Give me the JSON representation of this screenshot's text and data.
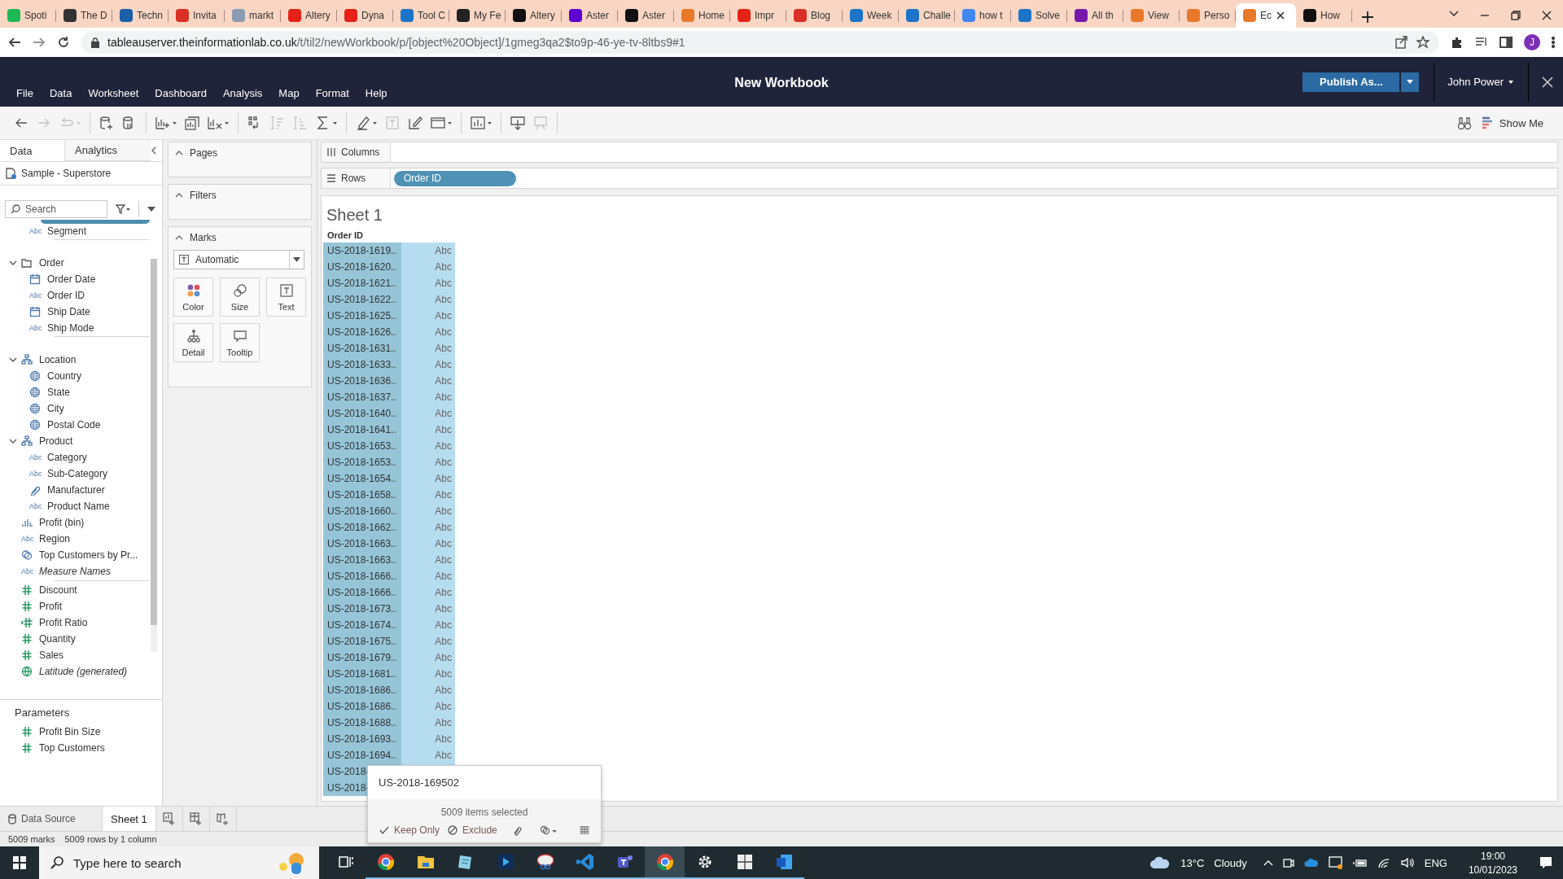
{
  "browser": {
    "tabs": [
      {
        "title": "Spoti",
        "selected": false
      },
      {
        "title": "The D",
        "selected": false
      },
      {
        "title": "Techn",
        "selected": false
      },
      {
        "title": "Invita",
        "selected": false
      },
      {
        "title": "markt",
        "selected": false
      },
      {
        "title": "Altery",
        "selected": false
      },
      {
        "title": "Dyna",
        "selected": false
      },
      {
        "title": "Tool C",
        "selected": false
      },
      {
        "title": "My Fe",
        "selected": false
      },
      {
        "title": "Altery",
        "selected": false
      },
      {
        "title": "Aster",
        "selected": false
      },
      {
        "title": "Aster",
        "selected": false
      },
      {
        "title": "Home",
        "selected": false
      },
      {
        "title": "Impr",
        "selected": false
      },
      {
        "title": "Blog",
        "selected": false
      },
      {
        "title": "Week",
        "selected": false
      },
      {
        "title": "Challe",
        "selected": false
      },
      {
        "title": "how t",
        "selected": false
      },
      {
        "title": "Solve",
        "selected": false
      },
      {
        "title": "All th",
        "selected": false
      },
      {
        "title": "View",
        "selected": false
      },
      {
        "title": "Perso",
        "selected": false
      },
      {
        "title": "Ec",
        "selected": true
      },
      {
        "title": "How",
        "selected": false
      }
    ],
    "address": {
      "host": "tableauserver.theinformationlab.co.uk",
      "path": "/t/til2/newWorkbook/p/[object%20Object]/1gmeg3qa2$to9p-46-ye-tv-8ltbs9#1"
    },
    "profile_initial": "J"
  },
  "app": {
    "menu": [
      "File",
      "Data",
      "Worksheet",
      "Dashboard",
      "Analysis",
      "Map",
      "Format",
      "Help"
    ],
    "title": "New Workbook",
    "publish_button": "Publish As...",
    "user": "John Power"
  },
  "toolbar": [
    [
      {
        "kind": "undo",
        "disabled": false
      },
      {
        "kind": "redo",
        "disabled": true
      },
      {
        "kind": "replay",
        "disabled": true
      }
    ],
    [
      {
        "kind": "new-data-source",
        "disabled": false
      },
      {
        "kind": "pause",
        "disabled": false
      }
    ],
    [
      {
        "kind": "new-sheet",
        "disabled": false
      },
      {
        "kind": "duplicate",
        "disabled": false
      },
      {
        "kind": "clear",
        "disabled": false
      }
    ],
    [
      {
        "kind": "swap",
        "disabled": false
      },
      {
        "kind": "sort-asc",
        "disabled": true
      },
      {
        "kind": "sort-desc",
        "disabled": true
      },
      {
        "kind": "totals",
        "disabled": false
      }
    ],
    [
      {
        "kind": "highlight",
        "disabled": false
      },
      {
        "kind": "labels",
        "disabled": true
      },
      {
        "kind": "format",
        "disabled": false
      },
      {
        "kind": "fit",
        "disabled": false
      }
    ],
    [
      {
        "kind": "cards",
        "disabled": false
      }
    ],
    [
      {
        "kind": "download",
        "disabled": false
      },
      {
        "kind": "device",
        "disabled": true
      }
    ]
  ],
  "show_me": "Show Me",
  "data_pane": {
    "tabs": [
      {
        "label": "Data",
        "selected": true
      },
      {
        "label": "Analytics",
        "selected": false
      }
    ],
    "data_source": "Sample - Superstore",
    "search": {
      "placeholder": "Search"
    },
    "fields": [
      {
        "kind": "folder",
        "children": [
          {
            "name": "Segment",
            "kind": "string",
            "icon_text": "Abc"
          }
        ]
      },
      {
        "name": "Order",
        "kind": "folder",
        "expanded": true,
        "children": [
          {
            "name": "Order Date",
            "kind": "date"
          },
          {
            "name": "Order ID",
            "kind": "string",
            "icon_text": "Abc"
          },
          {
            "name": "Ship Date",
            "kind": "date"
          },
          {
            "name": "Ship Mode",
            "kind": "string",
            "icon_text": "Abc"
          }
        ]
      },
      {
        "name": "Location",
        "kind": "hierarchy",
        "expanded": true,
        "children": [
          {
            "name": "Country",
            "kind": "geo"
          },
          {
            "name": "State",
            "kind": "geo"
          },
          {
            "name": "City",
            "kind": "geo"
          },
          {
            "name": "Postal Code",
            "kind": "geo"
          }
        ]
      },
      {
        "name": "Product",
        "kind": "hierarchy",
        "expanded": true,
        "children": [
          {
            "name": "Category",
            "kind": "string",
            "icon_text": "Abc"
          },
          {
            "name": "Sub-Category",
            "kind": "string",
            "icon_text": "Abc"
          },
          {
            "name": "Manufacturer",
            "kind": "attachment"
          },
          {
            "name": "Product Name",
            "kind": "string",
            "icon_text": "Abc"
          }
        ]
      },
      {
        "name": "Profit (bin)",
        "kind": "bin"
      },
      {
        "name": "Region",
        "kind": "string",
        "icon_text": "Abc"
      },
      {
        "name": "Top Customers by Pr...",
        "kind": "set"
      },
      {
        "name": "Measure Names",
        "kind": "measure-names",
        "icon_text": "Abc"
      },
      {
        "name": "Discount",
        "kind": "measure"
      },
      {
        "name": "Profit",
        "kind": "measure"
      },
      {
        "name": "Profit Ratio",
        "kind": "calc-measure"
      },
      {
        "name": "Quantity",
        "kind": "measure"
      },
      {
        "name": "Sales",
        "kind": "measure"
      },
      {
        "name": "Latitude (generated)",
        "kind": "generated-geo"
      }
    ],
    "parameters_title": "Parameters",
    "parameters": [
      {
        "name": "Profit Bin Size",
        "kind": "measure"
      },
      {
        "name": "Top Customers",
        "kind": "measure"
      }
    ]
  },
  "pages": {
    "title": "Pages"
  },
  "filters": {
    "title": "Filters"
  },
  "marks": {
    "title": "Marks",
    "type": "Automatic",
    "buttons": [
      {
        "kind": "color",
        "label": "Color"
      },
      {
        "kind": "size",
        "label": "Size"
      },
      {
        "kind": "text",
        "label": "Text"
      },
      {
        "kind": "detail",
        "label": "Detail"
      },
      {
        "kind": "tooltip",
        "label": "Tooltip"
      }
    ]
  },
  "shelves": [
    {
      "label": "Columns",
      "kind": "columns"
    },
    {
      "label": "Rows",
      "kind": "rows",
      "pills": [
        "Order ID"
      ]
    }
  ],
  "sheet": {
    "title": "Sheet 1",
    "column_header": "Order ID",
    "rows": [
      {
        "id": "US-2018-1619..",
        "value": "Abc"
      },
      {
        "id": "US-2018-1620..",
        "value": "Abc"
      },
      {
        "id": "US-2018-1621..",
        "value": "Abc"
      },
      {
        "id": "US-2018-1622..",
        "value": "Abc"
      },
      {
        "id": "US-2018-1625..",
        "value": "Abc"
      },
      {
        "id": "US-2018-1626..",
        "value": "Abc"
      },
      {
        "id": "US-2018-1631..",
        "value": "Abc"
      },
      {
        "id": "US-2018-1633..",
        "value": "Abc"
      },
      {
        "id": "US-2018-1636..",
        "value": "Abc"
      },
      {
        "id": "US-2018-1637..",
        "value": "Abc"
      },
      {
        "id": "US-2018-1640..",
        "value": "Abc"
      },
      {
        "id": "US-2018-1641..",
        "value": "Abc"
      },
      {
        "id": "US-2018-1653..",
        "value": "Abc"
      },
      {
        "id": "US-2018-1653..",
        "value": "Abc"
      },
      {
        "id": "US-2018-1654..",
        "value": "Abc"
      },
      {
        "id": "US-2018-1658..",
        "value": "Abc"
      },
      {
        "id": "US-2018-1660..",
        "value": "Abc"
      },
      {
        "id": "US-2018-1662..",
        "value": "Abc"
      },
      {
        "id": "US-2018-1663..",
        "value": "Abc"
      },
      {
        "id": "US-2018-1663..",
        "value": "Abc"
      },
      {
        "id": "US-2018-1666..",
        "value": "Abc"
      },
      {
        "id": "US-2018-1666..",
        "value": "Abc"
      },
      {
        "id": "US-2018-1673..",
        "value": "Abc"
      },
      {
        "id": "US-2018-1674..",
        "value": "Abc"
      },
      {
        "id": "US-2018-1675..",
        "value": "Abc"
      },
      {
        "id": "US-2018-1679..",
        "value": "Abc"
      },
      {
        "id": "US-2018-1681..",
        "value": "Abc"
      },
      {
        "id": "US-2018-1686..",
        "value": "Abc"
      },
      {
        "id": "US-2018-1686..",
        "value": "Abc"
      },
      {
        "id": "US-2018-1688..",
        "value": "Abc"
      },
      {
        "id": "US-2018-1693..",
        "value": "Abc"
      },
      {
        "id": "US-2018-1694..",
        "value": "Abc"
      },
      {
        "id": "US-2018-"
      },
      {
        "id": "US-2018-"
      }
    ]
  },
  "selection_tooltip": {
    "value": "US-2018-169502",
    "summary": "5009 items selected",
    "actions": [
      {
        "kind": "keep",
        "label": "Keep Only"
      },
      {
        "kind": "exclude",
        "label": "Exclude"
      }
    ]
  },
  "sheet_tabs": [
    {
      "kind": "data-source",
      "label": "Data Source",
      "selected": false
    },
    {
      "kind": "sheet",
      "label": "Sheet 1",
      "selected": true
    }
  ],
  "status_bar": [
    "5009 marks",
    "5009 rows by 1 column"
  ],
  "taskbar": {
    "search_placeholder": "Type here to search",
    "apps": [
      {
        "kind": "task-view",
        "running": false,
        "active": false
      },
      {
        "kind": "browser",
        "running": true,
        "active": false
      },
      {
        "kind": "folder",
        "running": true,
        "active": false
      },
      {
        "kind": "notepad",
        "running": true,
        "active": false
      },
      {
        "kind": "player",
        "running": true,
        "active": false
      },
      {
        "kind": "snip",
        "running": true,
        "active": false
      },
      {
        "kind": "code",
        "running": true,
        "active": false
      },
      {
        "kind": "teams",
        "running": true,
        "active": false
      },
      {
        "kind": "browser",
        "running": true,
        "active": true
      },
      {
        "kind": "gear",
        "running": true,
        "active": false
      },
      {
        "kind": "grid",
        "running": true,
        "active": false
      },
      {
        "kind": "word",
        "running": true,
        "active": false
      }
    ],
    "weather": {
      "temperature": "13°C",
      "condition": "Cloudy"
    },
    "language": "ENG",
    "time": "19:00",
    "date": "10/01/2023"
  }
}
